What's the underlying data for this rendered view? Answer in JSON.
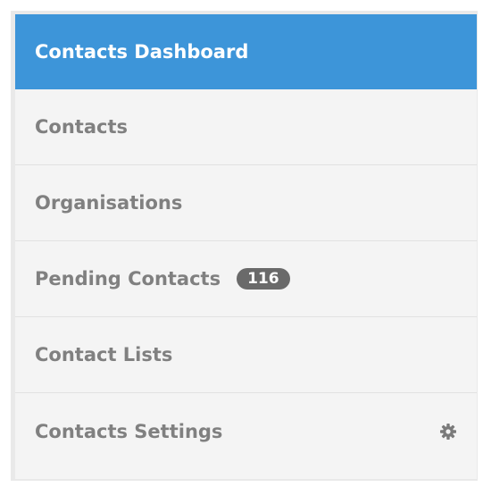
{
  "nav": {
    "items": [
      {
        "label": "Contacts Dashboard",
        "active": true
      },
      {
        "label": "Contacts"
      },
      {
        "label": "Organisations"
      },
      {
        "label": "Pending Contacts",
        "badge": "116"
      },
      {
        "label": "Contact Lists"
      },
      {
        "label": "Contacts Settings",
        "icon": "gear-icon"
      }
    ]
  },
  "colors": {
    "active_bg": "#3d95d9",
    "item_bg": "#f4f4f4",
    "item_text": "#808080",
    "badge_bg": "#6a6a6a"
  }
}
